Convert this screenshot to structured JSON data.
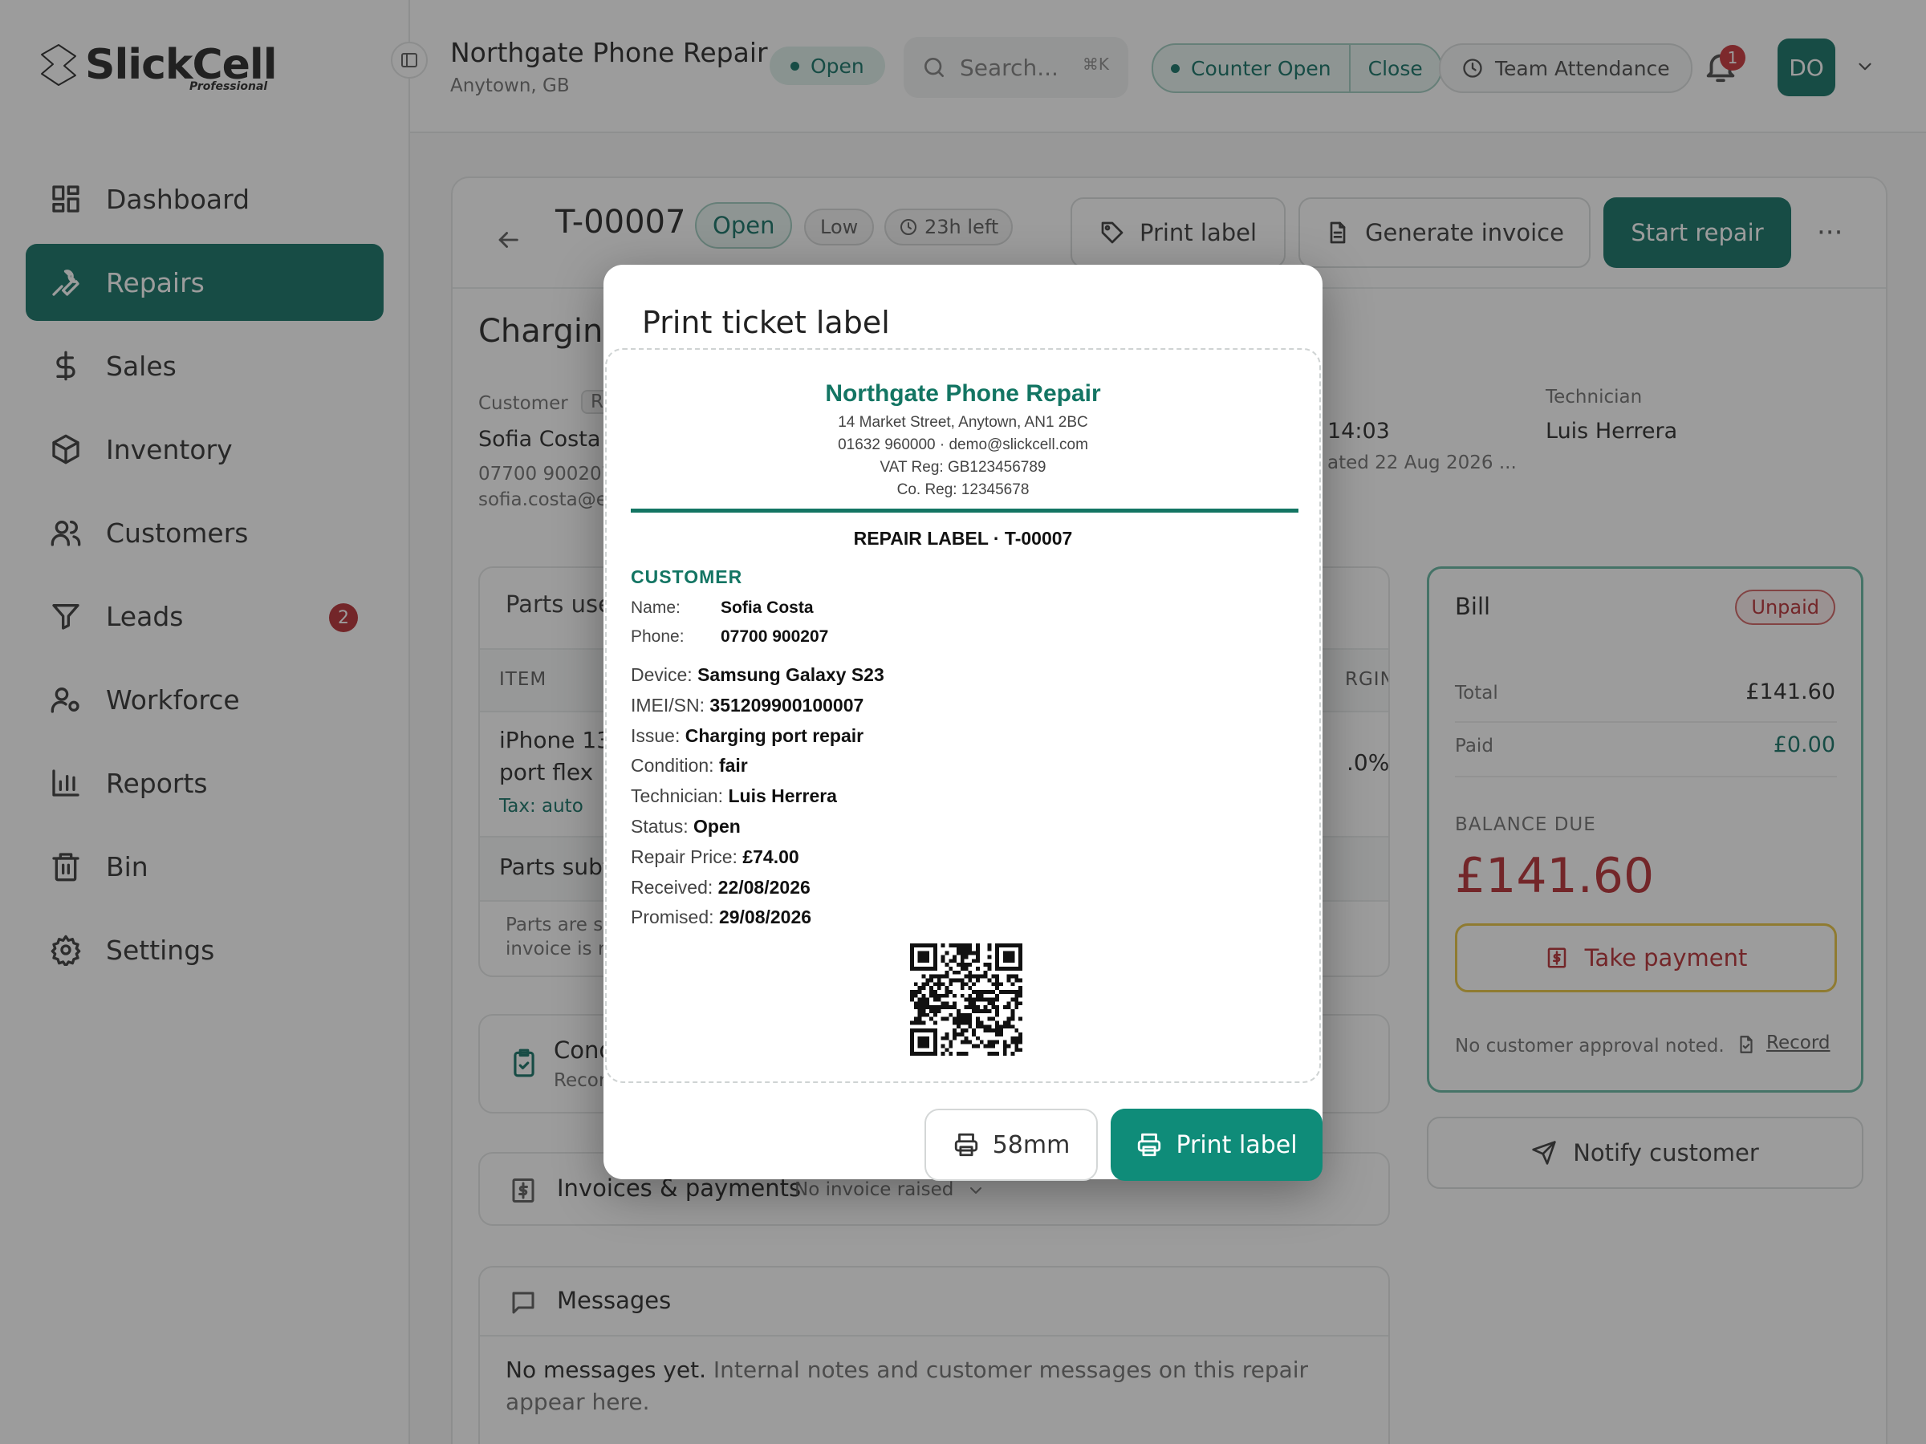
{
  "brand": {
    "name": "SlickCell",
    "tier": "Professional"
  },
  "store": {
    "name": "Northgate Phone Repair",
    "location": "Anytown, GB",
    "status": "Open"
  },
  "topbar": {
    "search_placeholder": "Search...",
    "search_shortcut": "⌘K",
    "counter_status": "Counter Open",
    "counter_close": "Close",
    "attendance": "Team Attendance",
    "notifications": "1",
    "user_initials": "DO"
  },
  "sidebar": {
    "items": [
      {
        "label": "Dashboard",
        "icon": "dashboard-icon"
      },
      {
        "label": "Repairs",
        "icon": "wrench-icon",
        "active": true
      },
      {
        "label": "Sales",
        "icon": "dollar-icon"
      },
      {
        "label": "Inventory",
        "icon": "box-icon"
      },
      {
        "label": "Customers",
        "icon": "users-icon"
      },
      {
        "label": "Leads",
        "icon": "filter-icon",
        "badge": "2"
      },
      {
        "label": "Workforce",
        "icon": "user-gear-icon"
      },
      {
        "label": "Reports",
        "icon": "bar-chart-icon"
      },
      {
        "label": "Bin",
        "icon": "trash-icon"
      },
      {
        "label": "Settings",
        "icon": "gear-icon"
      }
    ]
  },
  "ticket": {
    "id": "T-00007",
    "status": "Open",
    "priority": "Low",
    "time_left": "23h left",
    "actions": {
      "print_label": "Print label",
      "generate_invoice": "Generate invoice",
      "start_repair": "Start repair",
      "more": "···"
    },
    "title_fragment": "Charging",
    "customer_label": "Customer",
    "customer_tag": "R",
    "customer_name": "Sofia Costa",
    "customer_phone": "07700 900207",
    "customer_email": "sofia.costa@e",
    "time_fragment": "14:03",
    "updated_fragment": "ated 22 Aug 2026 ...",
    "technician_label": "Technician",
    "technician": "Luis Herrera"
  },
  "parts": {
    "title": "Parts use",
    "col_item": "ITEM",
    "col_margin": "RGIN",
    "item_line1": "iPhone 13",
    "item_line2": "port flex",
    "item_tax": "Tax: auto",
    "item_margin": ".0%",
    "subtotal": "Parts subt",
    "note_line1": "Parts are s",
    "note_line2": "invoice is r"
  },
  "conditions": {
    "title": "Cond",
    "sub": "Recor"
  },
  "invoices": {
    "title": "Invoices & payments",
    "status": "No invoice raised"
  },
  "messages": {
    "title": "Messages",
    "empty_bold": "No messages yet.",
    "empty_rest": "Internal notes and customer messages on this repair appear",
    "empty_rest2": "here."
  },
  "bill": {
    "title": "Bill",
    "status": "Unpaid",
    "total_label": "Total",
    "total": "£141.60",
    "paid_label": "Paid",
    "paid": "£0.00",
    "balance_label": "BALANCE DUE",
    "balance": "£141.60",
    "take_payment": "Take payment",
    "approval_note": "No customer approval noted.",
    "record": "Record"
  },
  "notify": "Notify customer",
  "modal": {
    "title": "Print ticket label",
    "label": {
      "store_name": "Northgate Phone Repair",
      "address": "14 Market Street, Anytown, AN1 2BC",
      "contact": "01632 960000 · demo@slickcell.com",
      "vat": "VAT Reg: GB123456789",
      "co_reg": "Co. Reg: 12345678",
      "heading": "REPAIR LABEL · T-00007",
      "customer_heading": "CUSTOMER",
      "name_label": "Name:",
      "name": "Sofia Costa",
      "phone_label": "Phone:",
      "phone": "07700 900207",
      "fields": [
        {
          "k": "Device:",
          "v": "Samsung Galaxy S23"
        },
        {
          "k": "IMEI/SN:",
          "v": "351209900100007"
        },
        {
          "k": "Issue:",
          "v": "Charging port repair"
        },
        {
          "k": "Condition:",
          "v": "fair"
        },
        {
          "k": "Technician:",
          "v": "Luis Herrera"
        },
        {
          "k": "Status:",
          "v": "Open"
        },
        {
          "k": "Repair Price:",
          "v": "£74.00"
        },
        {
          "k": "Received:",
          "v": "22/08/2026"
        },
        {
          "k": "Promised:",
          "v": "29/08/2026"
        }
      ]
    },
    "size_button": "58mm",
    "print_button": "Print label"
  },
  "colors": {
    "primary": "#0a6b5e",
    "accent": "#0f8c79",
    "danger": "#b3262b",
    "warning": "#e8c23a"
  }
}
